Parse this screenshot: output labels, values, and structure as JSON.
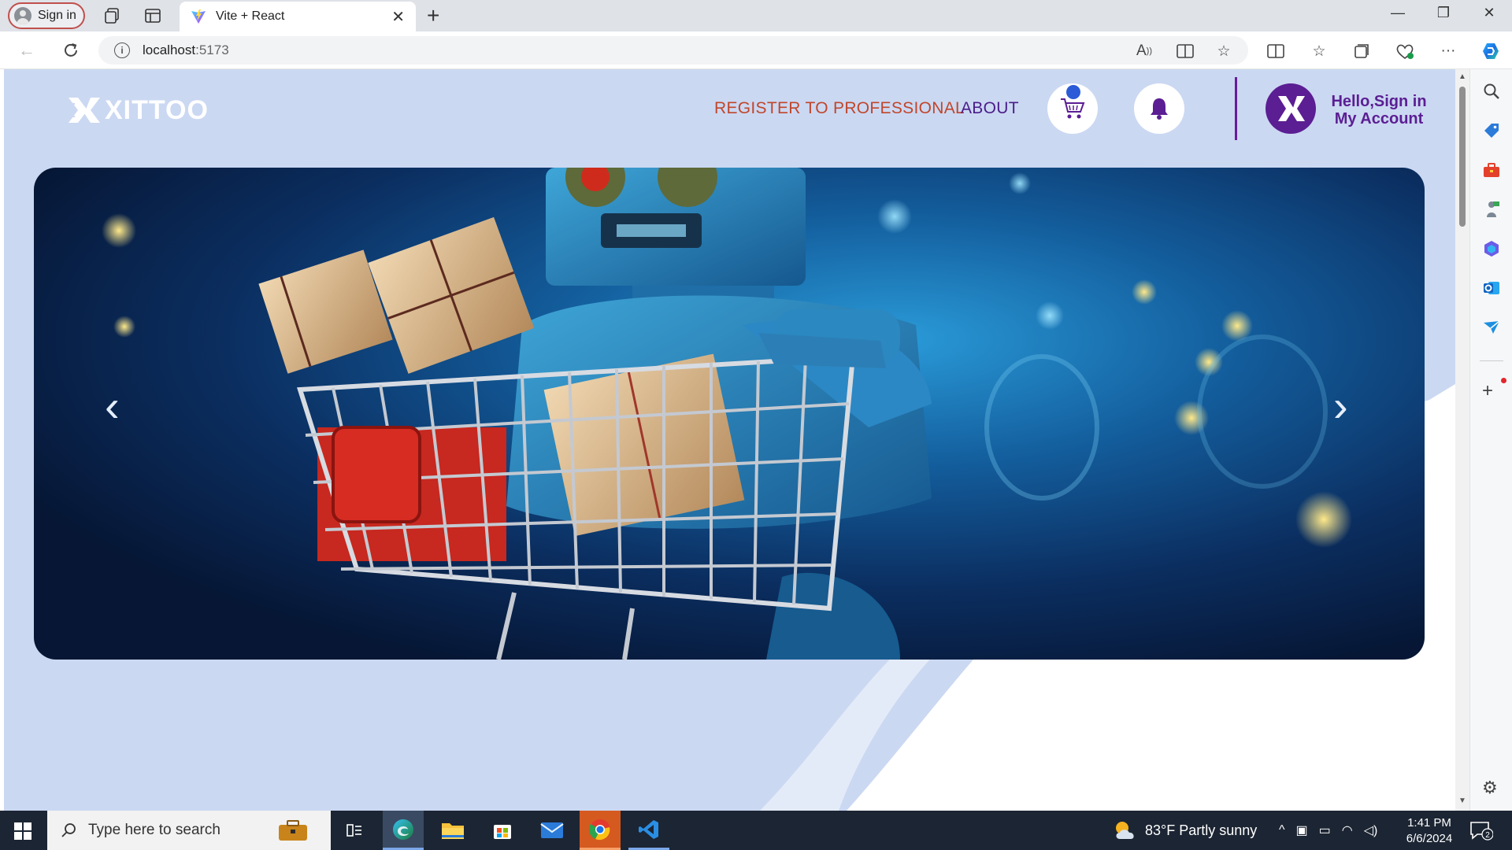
{
  "browser": {
    "profile_label": "Sign in",
    "tab_title": "Vite + React",
    "url_host": "localhost",
    "url_port": ":5173"
  },
  "site": {
    "brand": "XITTOO",
    "nav": {
      "register": "REGISTER TO PROFESSIONAL",
      "about": "ABOUT"
    },
    "account": {
      "line1": "Hello,Sign in",
      "line2": "My Account"
    },
    "carousel": {
      "prev_symbol": "‹",
      "next_symbol": "›"
    },
    "colors": {
      "page_bg": "#cbd8f2",
      "accent_purple": "#5b1e93",
      "register_orange": "#c0462b"
    }
  },
  "taskbar": {
    "search_placeholder": "Type here to search",
    "weather": "83°F  Partly sunny",
    "time": "1:41 PM",
    "date": "6/6/2024",
    "notification_count": "2"
  },
  "icons": {
    "titlebar": [
      "workspaces-icon",
      "tab-actions-icon"
    ],
    "address": [
      "read-aloud-icon",
      "immersive-reader-icon",
      "favorite-star-icon",
      "split-screen-icon",
      "favorites-icon",
      "collections-icon",
      "browser-essentials-icon",
      "more-icon",
      "copilot-icon"
    ],
    "sidebar": [
      "search-icon",
      "shopping-tag-icon",
      "tools-icon",
      "games-icon",
      "microsoft365-icon",
      "outlook-icon",
      "send-icon",
      "add-icon",
      "settings-icon"
    ]
  }
}
